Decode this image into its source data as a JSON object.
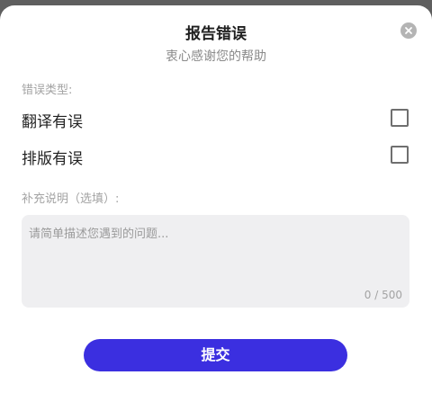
{
  "dialog": {
    "title": "报告错误",
    "subtitle": "衷心感谢您的帮助",
    "close_icon": "close-icon"
  },
  "error_type": {
    "label": "错误类型:",
    "options": [
      {
        "label": "翻译有误",
        "checked": false
      },
      {
        "label": "排版有误",
        "checked": false
      }
    ]
  },
  "description": {
    "label": "补充说明（选填）:",
    "placeholder": "请简单描述您遇到的问题...",
    "value": "",
    "counter": "0 / 500"
  },
  "submit": {
    "label": "提交"
  },
  "colors": {
    "accent": "#3b2fe0",
    "overlay": "#5f5f5f",
    "field_bg": "#efeff1"
  }
}
